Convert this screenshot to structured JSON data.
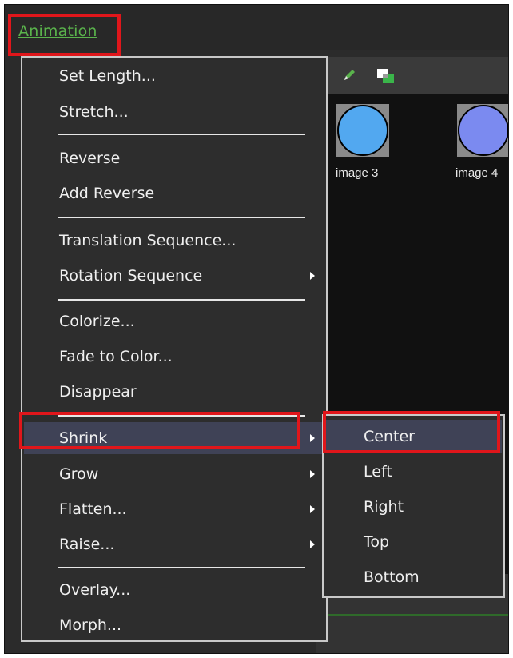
{
  "menubar": {
    "title": "Animation"
  },
  "canvas": {
    "images": [
      {
        "label": "image 3",
        "color": "#52a8f0"
      },
      {
        "label": "image 4",
        "color": "#7b8af0"
      }
    ]
  },
  "menu": {
    "items": [
      {
        "label": "Set Length...",
        "has_submenu": false
      },
      {
        "label": "Stretch...",
        "has_submenu": false
      },
      {
        "label": "Reverse",
        "has_submenu": false
      },
      {
        "label": "Add Reverse",
        "has_submenu": false
      },
      {
        "label": "Translation Sequence...",
        "has_submenu": false
      },
      {
        "label": "Rotation Sequence",
        "has_submenu": true
      },
      {
        "label": "Colorize...",
        "has_submenu": false
      },
      {
        "label": "Fade to Color...",
        "has_submenu": false
      },
      {
        "label": "Disappear",
        "has_submenu": false
      },
      {
        "label": "Shrink",
        "has_submenu": true,
        "selected": true
      },
      {
        "label": "Grow",
        "has_submenu": true
      },
      {
        "label": "Flatten...",
        "has_submenu": true
      },
      {
        "label": "Raise...",
        "has_submenu": true
      },
      {
        "label": "Overlay...",
        "has_submenu": false
      },
      {
        "label": "Morph...",
        "has_submenu": false
      }
    ]
  },
  "submenu": {
    "items": [
      {
        "label": "Center",
        "selected": true
      },
      {
        "label": "Left"
      },
      {
        "label": "Right"
      },
      {
        "label": "Top"
      },
      {
        "label": "Bottom"
      }
    ]
  },
  "colors": {
    "highlight": "#e0161b",
    "accent_text": "#5ab34c",
    "selection": "#3f4256"
  }
}
